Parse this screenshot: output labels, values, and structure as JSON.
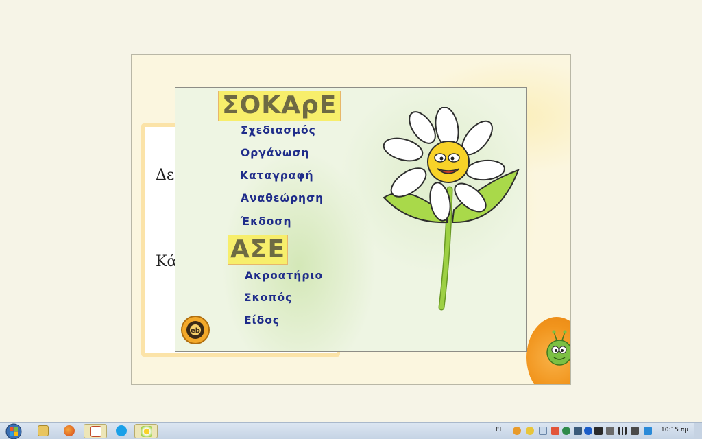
{
  "panel": {
    "heading1": "ΣΟΚΑρΕ",
    "menu1": [
      "Σχεδιασμός",
      "Οργάνωση",
      "Καταγραφή",
      "Αναθεώρηση",
      "Έκδοση"
    ],
    "heading2": "ΑΣΕ",
    "menu2": [
      "Ακροατήριο",
      "Σκοπός",
      "Είδος"
    ]
  },
  "background_card": {
    "line1": "Δεν",
    "line2": "Κά"
  },
  "taskbar": {
    "language": "EL",
    "clock": "10:15 πμ",
    "apps": [
      "windows-explorer-icon",
      "firefox-icon",
      "presentation-icon",
      "skype-icon",
      "flower-app-icon"
    ]
  },
  "colors": {
    "heading_fill": "#f7ee6b",
    "menu_text": "#1f2c8a",
    "panel_bg": "#eef5e3"
  }
}
